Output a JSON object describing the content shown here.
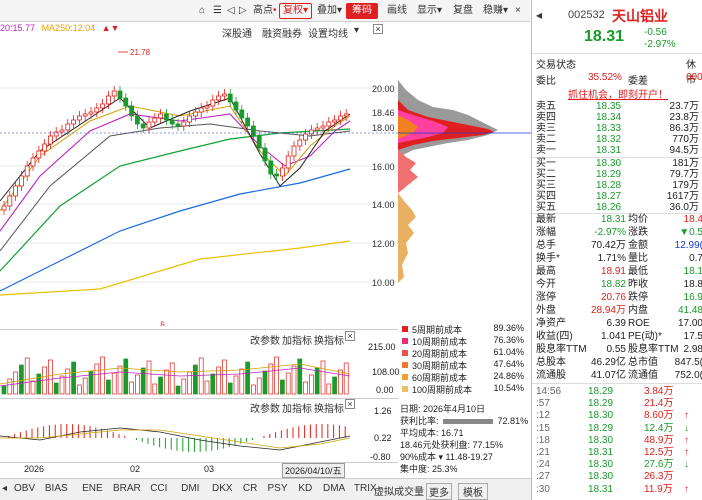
{
  "toolbar": {
    "icons": [
      "home-icon",
      "list-icon",
      "prev-icon",
      "next-icon"
    ],
    "points": "高点",
    "adjust": "复权",
    "overlay": "叠加",
    "chips": "筹码",
    "draw": "画线",
    "display": "显示",
    "replay": "复盘",
    "more": "稳赚",
    "close_glyph": "×"
  },
  "ma_line": {
    "ma1": "20:15.77",
    "ma2": "MA250:12.04",
    "arrow": "▲▼"
  },
  "main_tabs": {
    "tab1": "深股通",
    "tab2": "融资融券",
    "tab3": "设置均线"
  },
  "price_axis": {
    "labels": [
      "20.00",
      "18.46",
      "18.00",
      "16.00",
      "14.00",
      "12.00",
      "10.00"
    ]
  },
  "annotations": {
    "high": "21.78",
    "flag": "§"
  },
  "indicator1": {
    "btn1": "改参数",
    "btn2": "加指标",
    "btn3": "换指标",
    "labels": [
      "215.00",
      "108.00",
      "0.00"
    ]
  },
  "indicator2": {
    "btn1": "改参数",
    "btn2": "加指标",
    "btn3": "换指标",
    "labels": [
      "1.26",
      "0.22",
      "-0.80"
    ]
  },
  "cost_legend": [
    {
      "label": "5周期前成本",
      "value": "89.36%",
      "color": "#e02020"
    },
    {
      "label": "10周期前成本",
      "value": "76.36%",
      "color": "#e83070"
    },
    {
      "label": "20周期前成本",
      "value": "61.04%",
      "color": "#f05050"
    },
    {
      "label": "30周期前成本",
      "value": "47.64%",
      "color": "#f07830"
    },
    {
      "label": "60周期前成本",
      "value": "24.86%",
      "color": "#f0a030"
    },
    {
      "label": "100周期前成本",
      "value": "10.54%",
      "color": "#e8c060"
    }
  ],
  "cost_info": {
    "date": "日期: 2026年4月10日",
    "profit_label": "获利比率:",
    "profit_value": "72.81%",
    "avg_cost": "平均成本: 16.71",
    "profit_at": "18.46元处获利盘: 77.15%",
    "range": "90%成本 ▾  11.48-19.27",
    "concentration": "集中度: 25.3%"
  },
  "x_axis": {
    "y2026": "2026",
    "m02": "02",
    "m03": "03",
    "cursor_date": "2026/04/10/五"
  },
  "bottom_tabs": [
    "OBV",
    "BIAS",
    "ENE",
    "BRAR",
    "CCI",
    "DMI",
    "DKX",
    "CR",
    "PSY",
    "KD",
    "DMA",
    "TRIX"
  ],
  "bottom_right": {
    "virtual": "虚拟成交量",
    "more": "更多",
    "template": "模板"
  },
  "stock": {
    "code": "002532",
    "name": "天山铝业",
    "price": "18.31",
    "change": "-0.56",
    "change_pct": "-2.97%",
    "status_label": "交易状态",
    "status_value": "休市",
    "wei_bi_label": "委比",
    "wei_bi_value": "35.52%",
    "wei_cha_label": "委差",
    "wei_cha_value": "600",
    "banner": "抓住机会，即刻开户！"
  },
  "asks": [
    {
      "label": "卖五",
      "price": "18.35",
      "vol": "23.7万"
    },
    {
      "label": "卖四",
      "price": "18.34",
      "vol": "23.8万"
    },
    {
      "label": "卖三",
      "price": "18.33",
      "vol": "86.3万"
    },
    {
      "label": "卖二",
      "price": "18.32",
      "vol": "770万"
    },
    {
      "label": "卖一",
      "price": "18.31",
      "vol": "94.5万"
    }
  ],
  "bids": [
    {
      "label": "买一",
      "price": "18.30",
      "vol": "181万"
    },
    {
      "label": "买二",
      "price": "18.29",
      "vol": "79.7万"
    },
    {
      "label": "买三",
      "price": "18.28",
      "vol": "179万"
    },
    {
      "label": "买四",
      "price": "18.27",
      "vol": "1617万"
    },
    {
      "label": "买五",
      "price": "18.26",
      "vol": "36.0万"
    }
  ],
  "quote": [
    {
      "l1": "最新",
      "v1": "18.31",
      "c1": "green",
      "l2": "均价",
      "v2": "18.4",
      "c2": "red"
    },
    {
      "l1": "涨幅",
      "v1": "-2.97%",
      "c1": "green",
      "l2": "涨跌",
      "v2": "▼0.5",
      "c2": "green"
    },
    {
      "l1": "总手",
      "v1": "70.42万",
      "c1": "",
      "l2": "金额",
      "v2": "12.99(",
      "c2": "blue"
    },
    {
      "l1": "换手*",
      "v1": "1.71%",
      "c1": "",
      "l2": "量比",
      "v2": "0.7",
      "c2": ""
    },
    {
      "l1": "最高",
      "v1": "18.91",
      "c1": "red",
      "l2": "最低",
      "v2": "18.1",
      "c2": "green"
    },
    {
      "l1": "今开",
      "v1": "18.82",
      "c1": "green",
      "l2": "昨收",
      "v2": "18.8",
      "c2": ""
    },
    {
      "l1": "涨停",
      "v1": "20.76",
      "c1": "red",
      "l2": "跌停",
      "v2": "16.9",
      "c2": "green"
    },
    {
      "l1": "外盘",
      "v1": "28.94万",
      "c1": "red",
      "l2": "内盘",
      "v2": "41.48",
      "c2": "green"
    },
    {
      "l1": "净资产",
      "v1": "6.39",
      "c1": "",
      "l2": "ROE",
      "v2": "17.00",
      "c2": ""
    },
    {
      "l1": "收益(四)",
      "v1": "1.041",
      "c1": "",
      "l2": "PE(动)*",
      "v2": "17.5",
      "c2": ""
    },
    {
      "l1": "股息率TTM",
      "v1": "0.55",
      "c1": "",
      "l2": "股息率TTM",
      "v2": "2.98",
      "c2": ""
    },
    {
      "l1": "总股本",
      "v1": "46.29亿",
      "c1": "",
      "l2": "总市值",
      "v2": "847.5(",
      "c2": ""
    },
    {
      "l1": "流通股",
      "v1": "41.07亿",
      "c1": "",
      "l2": "流通值",
      "v2": "752.0(",
      "c2": ""
    }
  ],
  "trades": [
    {
      "time": "14:56",
      "price": "18.29",
      "vol": "3.84万",
      "dir": ""
    },
    {
      "time": ":57",
      "price": "18.29",
      "vol": "21.4万",
      "dir": ""
    },
    {
      "time": ":12",
      "price": "18.30",
      "vol": "8.60万",
      "dir": "up"
    },
    {
      "time": ":15",
      "price": "18.29",
      "vol": "12.4万",
      "dir": "down"
    },
    {
      "time": ":18",
      "price": "18.30",
      "vol": "48.9万",
      "dir": "up"
    },
    {
      "time": ":21",
      "price": "18.31",
      "vol": "12.5万",
      "dir": "up"
    },
    {
      "time": ":24",
      "price": "18.30",
      "vol": "27.6万",
      "dir": "down"
    },
    {
      "time": ":27",
      "price": "18.30",
      "vol": "26.3万",
      "dir": ""
    },
    {
      "time": ":30",
      "price": "18.31",
      "vol": "11.9万",
      "dir": "up"
    }
  ],
  "colors": {
    "up": "#e0201a",
    "down": "#1a9a2a",
    "ma5": "#222222",
    "ma10": "#d0a000",
    "ma20": "#c020c0",
    "ma60": "#10a030",
    "ma120": "#1a6ae0",
    "ma250": "#e8c000"
  }
}
